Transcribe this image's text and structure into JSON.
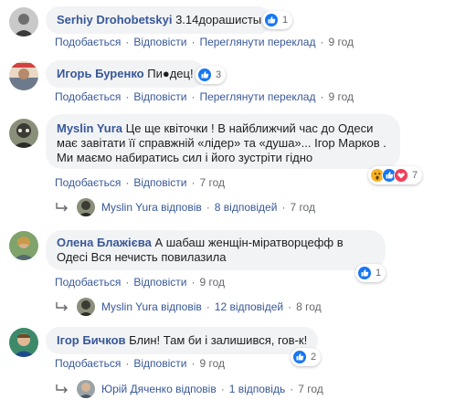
{
  "comments": [
    {
      "author": "Serhiy Drohobetskyi",
      "text": "3.14дорашисты",
      "reactions": [
        "like-icon"
      ],
      "reaction_count": "1",
      "actions": {
        "like": "Подобається",
        "reply": "Відповісти",
        "translate": "Переглянути переклад",
        "time": "9 год"
      }
    },
    {
      "author": "Игорь Буренко",
      "text": "Пи●дец!",
      "reactions": [
        "like-icon"
      ],
      "reaction_count": "3",
      "actions": {
        "like": "Подобається",
        "reply": "Відповісти",
        "translate": "Переглянути переклад",
        "time": "9 год"
      }
    },
    {
      "author": "Myslin Yura",
      "text": "Це ще квіточки ! В найближчий час до Одеси має завітати її справжній «лідер» та «душа»... Ігор Марков . Ми маємо набиратись сил і його зустріти гідно",
      "reactions": [
        "wow-icon",
        "like-icon",
        "love-icon"
      ],
      "reaction_count": "7",
      "actions": {
        "like": "Подобається",
        "reply": "Відповісти",
        "time": "7 год"
      },
      "replies": {
        "name": "Myslin Yura відповів",
        "count": "8 відповідей",
        "time": "7 год"
      }
    },
    {
      "author": "Олена Блажієва",
      "text": "А шабаш женщін-міратворцефф в Одесі Вся нечисть повилазила",
      "reactions": [
        "like-icon"
      ],
      "reaction_count": "1",
      "actions": {
        "like": "Подобається",
        "reply": "Відповісти",
        "time": "9 год"
      },
      "replies": {
        "name": "Myslin Yura відповів",
        "count": "12 відповідей",
        "time": "8 год"
      }
    },
    {
      "author": "Ігор Бичков",
      "text": "Блин! Там би і залишився, гов-к!",
      "reactions": [
        "like-icon"
      ],
      "reaction_count": "2",
      "actions": {
        "like": "Подобається",
        "reply": "Відповісти",
        "time": "9 год"
      },
      "replies": {
        "name": "Юрій Дяченко відповів",
        "count": "1 відповідь",
        "time": "7 год"
      }
    }
  ],
  "separator": "·",
  "colors": {
    "link": "#385898",
    "bubble": "#f2f3f5",
    "like": "#1877f2",
    "love": "#f33e58",
    "wow": "#f7b125"
  }
}
